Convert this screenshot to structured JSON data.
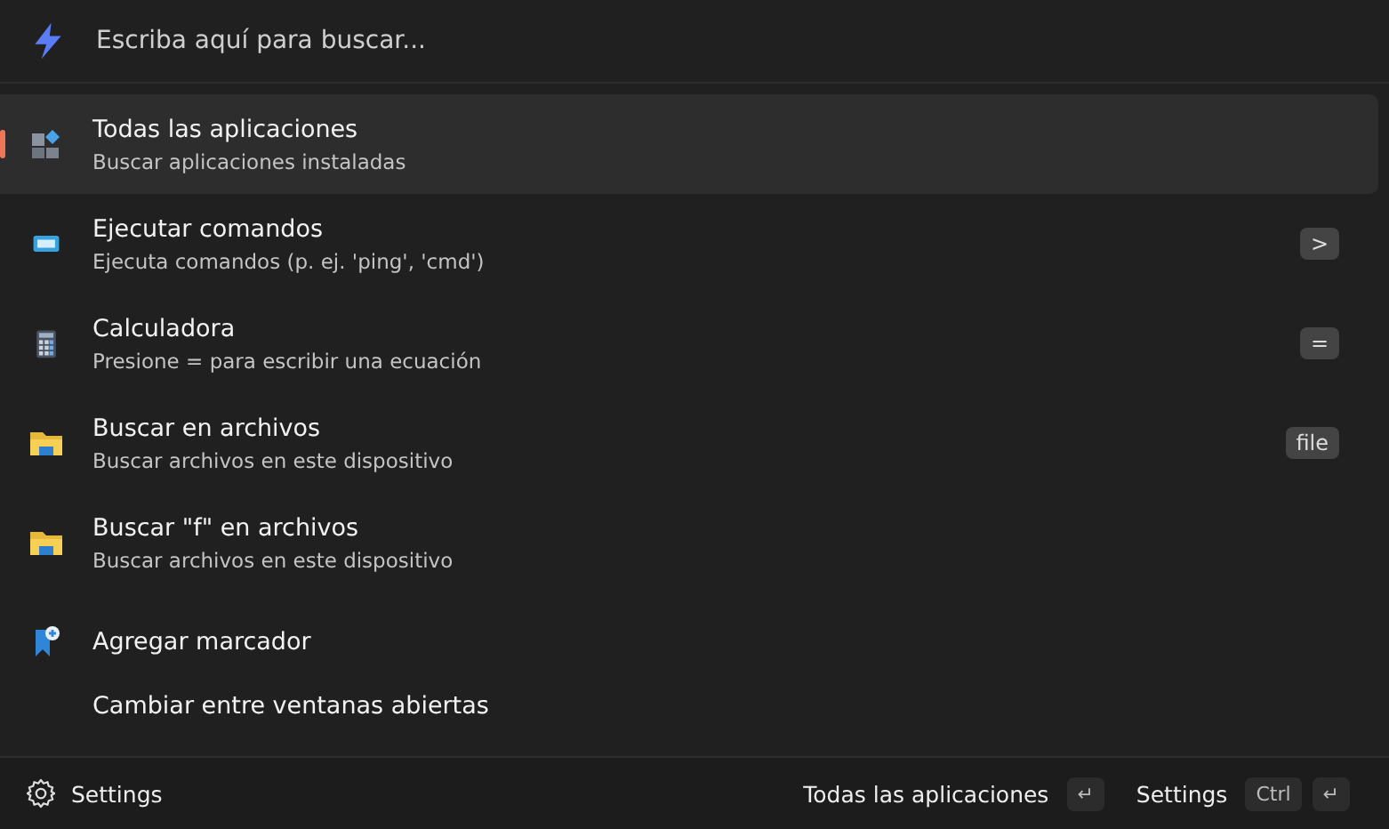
{
  "search": {
    "placeholder": "Escriba aquí para buscar..."
  },
  "results": [
    {
      "kind": "apps",
      "title": "Todas las aplicaciones",
      "subtitle": "Buscar aplicaciones instaladas",
      "selected": true
    },
    {
      "kind": "terminal",
      "title": "Ejecutar comandos",
      "subtitle": "Ejecuta comandos (p. ej. 'ping', 'cmd')",
      "shortcut": ">",
      "selected": false
    },
    {
      "kind": "calculator",
      "title": "Calculadora",
      "subtitle": "Presione = para escribir una ecuación",
      "shortcut": "=",
      "selected": false
    },
    {
      "kind": "folder",
      "title": "Buscar en archivos",
      "subtitle": "Buscar archivos en este dispositivo",
      "shortcut": "file",
      "selected": false
    },
    {
      "kind": "folder",
      "title": "Buscar \"f\" en archivos",
      "subtitle": "Buscar archivos en este dispositivo",
      "selected": false
    },
    {
      "kind": "bookmark",
      "title": "Agregar marcador",
      "selected": false
    },
    {
      "kind": "plain",
      "title": "Cambiar entre ventanas abiertas",
      "selected": false
    }
  ],
  "footer": {
    "settings": "Settings",
    "actions": [
      {
        "label": "Todas las aplicaciones",
        "keys": [
          "↵"
        ]
      },
      {
        "label": "Settings",
        "keys": [
          "Ctrl",
          "↵"
        ]
      }
    ]
  }
}
